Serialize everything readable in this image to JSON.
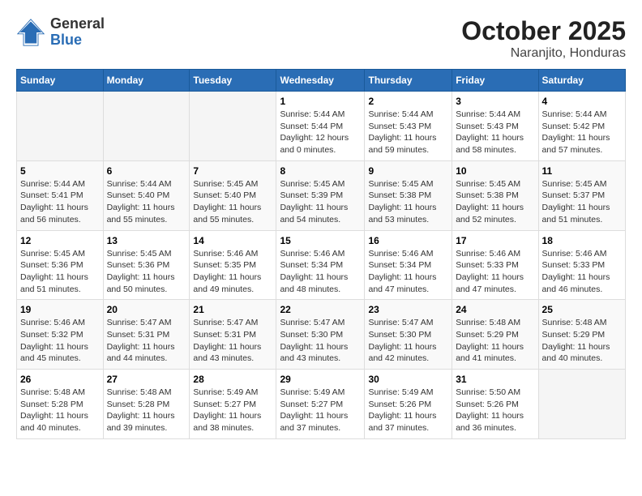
{
  "header": {
    "logo_general": "General",
    "logo_blue": "Blue",
    "month_title": "October 2025",
    "location": "Naranjito, Honduras"
  },
  "days_of_week": [
    "Sunday",
    "Monday",
    "Tuesday",
    "Wednesday",
    "Thursday",
    "Friday",
    "Saturday"
  ],
  "weeks": [
    [
      {
        "day": "",
        "sunrise": "",
        "sunset": "",
        "daylight": "",
        "empty": true
      },
      {
        "day": "",
        "sunrise": "",
        "sunset": "",
        "daylight": "",
        "empty": true
      },
      {
        "day": "",
        "sunrise": "",
        "sunset": "",
        "daylight": "",
        "empty": true
      },
      {
        "day": "1",
        "sunrise": "Sunrise: 5:44 AM",
        "sunset": "Sunset: 5:44 PM",
        "daylight": "Daylight: 12 hours and 0 minutes."
      },
      {
        "day": "2",
        "sunrise": "Sunrise: 5:44 AM",
        "sunset": "Sunset: 5:43 PM",
        "daylight": "Daylight: 11 hours and 59 minutes."
      },
      {
        "day": "3",
        "sunrise": "Sunrise: 5:44 AM",
        "sunset": "Sunset: 5:43 PM",
        "daylight": "Daylight: 11 hours and 58 minutes."
      },
      {
        "day": "4",
        "sunrise": "Sunrise: 5:44 AM",
        "sunset": "Sunset: 5:42 PM",
        "daylight": "Daylight: 11 hours and 57 minutes."
      }
    ],
    [
      {
        "day": "5",
        "sunrise": "Sunrise: 5:44 AM",
        "sunset": "Sunset: 5:41 PM",
        "daylight": "Daylight: 11 hours and 56 minutes."
      },
      {
        "day": "6",
        "sunrise": "Sunrise: 5:44 AM",
        "sunset": "Sunset: 5:40 PM",
        "daylight": "Daylight: 11 hours and 55 minutes."
      },
      {
        "day": "7",
        "sunrise": "Sunrise: 5:45 AM",
        "sunset": "Sunset: 5:40 PM",
        "daylight": "Daylight: 11 hours and 55 minutes."
      },
      {
        "day": "8",
        "sunrise": "Sunrise: 5:45 AM",
        "sunset": "Sunset: 5:39 PM",
        "daylight": "Daylight: 11 hours and 54 minutes."
      },
      {
        "day": "9",
        "sunrise": "Sunrise: 5:45 AM",
        "sunset": "Sunset: 5:38 PM",
        "daylight": "Daylight: 11 hours and 53 minutes."
      },
      {
        "day": "10",
        "sunrise": "Sunrise: 5:45 AM",
        "sunset": "Sunset: 5:38 PM",
        "daylight": "Daylight: 11 hours and 52 minutes."
      },
      {
        "day": "11",
        "sunrise": "Sunrise: 5:45 AM",
        "sunset": "Sunset: 5:37 PM",
        "daylight": "Daylight: 11 hours and 51 minutes."
      }
    ],
    [
      {
        "day": "12",
        "sunrise": "Sunrise: 5:45 AM",
        "sunset": "Sunset: 5:36 PM",
        "daylight": "Daylight: 11 hours and 51 minutes."
      },
      {
        "day": "13",
        "sunrise": "Sunrise: 5:45 AM",
        "sunset": "Sunset: 5:36 PM",
        "daylight": "Daylight: 11 hours and 50 minutes."
      },
      {
        "day": "14",
        "sunrise": "Sunrise: 5:46 AM",
        "sunset": "Sunset: 5:35 PM",
        "daylight": "Daylight: 11 hours and 49 minutes."
      },
      {
        "day": "15",
        "sunrise": "Sunrise: 5:46 AM",
        "sunset": "Sunset: 5:34 PM",
        "daylight": "Daylight: 11 hours and 48 minutes."
      },
      {
        "day": "16",
        "sunrise": "Sunrise: 5:46 AM",
        "sunset": "Sunset: 5:34 PM",
        "daylight": "Daylight: 11 hours and 47 minutes."
      },
      {
        "day": "17",
        "sunrise": "Sunrise: 5:46 AM",
        "sunset": "Sunset: 5:33 PM",
        "daylight": "Daylight: 11 hours and 47 minutes."
      },
      {
        "day": "18",
        "sunrise": "Sunrise: 5:46 AM",
        "sunset": "Sunset: 5:33 PM",
        "daylight": "Daylight: 11 hours and 46 minutes."
      }
    ],
    [
      {
        "day": "19",
        "sunrise": "Sunrise: 5:46 AM",
        "sunset": "Sunset: 5:32 PM",
        "daylight": "Daylight: 11 hours and 45 minutes."
      },
      {
        "day": "20",
        "sunrise": "Sunrise: 5:47 AM",
        "sunset": "Sunset: 5:31 PM",
        "daylight": "Daylight: 11 hours and 44 minutes."
      },
      {
        "day": "21",
        "sunrise": "Sunrise: 5:47 AM",
        "sunset": "Sunset: 5:31 PM",
        "daylight": "Daylight: 11 hours and 43 minutes."
      },
      {
        "day": "22",
        "sunrise": "Sunrise: 5:47 AM",
        "sunset": "Sunset: 5:30 PM",
        "daylight": "Daylight: 11 hours and 43 minutes."
      },
      {
        "day": "23",
        "sunrise": "Sunrise: 5:47 AM",
        "sunset": "Sunset: 5:30 PM",
        "daylight": "Daylight: 11 hours and 42 minutes."
      },
      {
        "day": "24",
        "sunrise": "Sunrise: 5:48 AM",
        "sunset": "Sunset: 5:29 PM",
        "daylight": "Daylight: 11 hours and 41 minutes."
      },
      {
        "day": "25",
        "sunrise": "Sunrise: 5:48 AM",
        "sunset": "Sunset: 5:29 PM",
        "daylight": "Daylight: 11 hours and 40 minutes."
      }
    ],
    [
      {
        "day": "26",
        "sunrise": "Sunrise: 5:48 AM",
        "sunset": "Sunset: 5:28 PM",
        "daylight": "Daylight: 11 hours and 40 minutes."
      },
      {
        "day": "27",
        "sunrise": "Sunrise: 5:48 AM",
        "sunset": "Sunset: 5:28 PM",
        "daylight": "Daylight: 11 hours and 39 minutes."
      },
      {
        "day": "28",
        "sunrise": "Sunrise: 5:49 AM",
        "sunset": "Sunset: 5:27 PM",
        "daylight": "Daylight: 11 hours and 38 minutes."
      },
      {
        "day": "29",
        "sunrise": "Sunrise: 5:49 AM",
        "sunset": "Sunset: 5:27 PM",
        "daylight": "Daylight: 11 hours and 37 minutes."
      },
      {
        "day": "30",
        "sunrise": "Sunrise: 5:49 AM",
        "sunset": "Sunset: 5:26 PM",
        "daylight": "Daylight: 11 hours and 37 minutes."
      },
      {
        "day": "31",
        "sunrise": "Sunrise: 5:50 AM",
        "sunset": "Sunset: 5:26 PM",
        "daylight": "Daylight: 11 hours and 36 minutes."
      },
      {
        "day": "",
        "sunrise": "",
        "sunset": "",
        "daylight": "",
        "empty": true
      }
    ]
  ]
}
